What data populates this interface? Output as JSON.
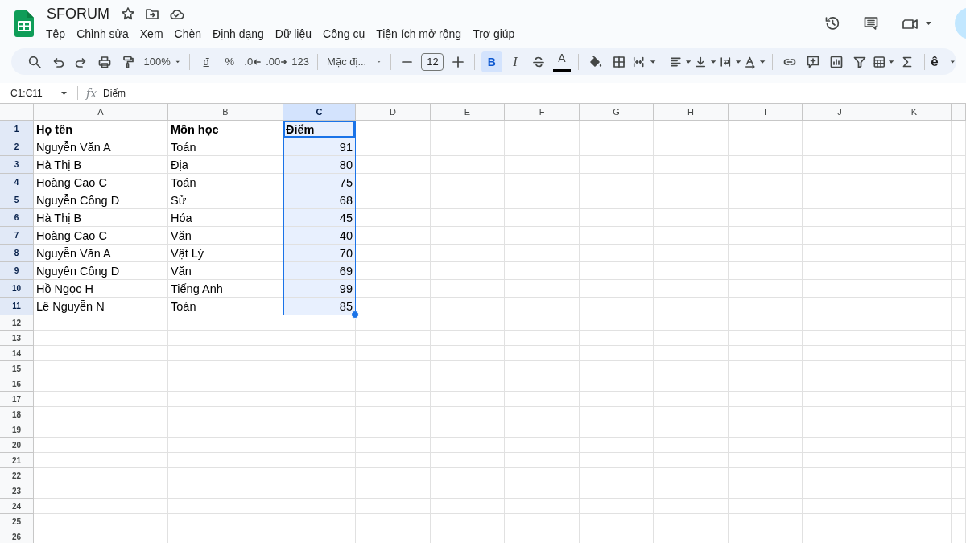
{
  "document": {
    "title": "SFORUM"
  },
  "menu": [
    "Tệp",
    "Chỉnh sửa",
    "Xem",
    "Chèn",
    "Định dạng",
    "Dữ liệu",
    "Công cụ",
    "Tiện ích mở rộng",
    "Trợ giúp"
  ],
  "toolbar": {
    "zoom": "100%",
    "currency": "đ",
    "percent": "%",
    "decrease_decimal": ".0",
    "increase_decimal": ".00",
    "number_format": "123",
    "font": "Mặc đị...",
    "font_size": "12",
    "bold": {
      "label": "B",
      "on": true
    },
    "italic": {
      "label": "I",
      "on": false
    },
    "text_color": {
      "label": "A",
      "color": "#000000"
    },
    "input_tools": "ê"
  },
  "formula_bar": {
    "name_box": "C1:C11",
    "fx": "fx",
    "value": "Điểm"
  },
  "columns": [
    {
      "label": "A",
      "selected": false,
      "align_right": false
    },
    {
      "label": "B",
      "selected": false,
      "align_right": false
    },
    {
      "label": "C",
      "selected": true,
      "align_right": true
    },
    {
      "label": "D",
      "selected": false
    },
    {
      "label": "E",
      "selected": false
    },
    {
      "label": "F",
      "selected": false
    },
    {
      "label": "G",
      "selected": false
    },
    {
      "label": "H",
      "selected": false
    },
    {
      "label": "I",
      "selected": false
    },
    {
      "label": "J",
      "selected": false
    },
    {
      "label": "K",
      "selected": false
    }
  ],
  "rows": [
    {
      "number": "1",
      "selected": true,
      "kind": "header",
      "cells": [
        "Họ tên",
        "Môn học",
        "Điểm"
      ]
    },
    {
      "number": "2",
      "selected": true,
      "kind": "data",
      "cells": [
        "Nguyễn Văn A",
        "Toán",
        "91"
      ]
    },
    {
      "number": "3",
      "selected": true,
      "kind": "data",
      "cells": [
        "Hà Thị B",
        "Địa",
        "80"
      ]
    },
    {
      "number": "4",
      "selected": true,
      "kind": "data",
      "cells": [
        "Hoàng Cao C",
        "Toán",
        "75"
      ]
    },
    {
      "number": "5",
      "selected": true,
      "kind": "data",
      "cells": [
        "Nguyễn Công D",
        "Sử",
        "68"
      ]
    },
    {
      "number": "6",
      "selected": true,
      "kind": "data",
      "cells": [
        "Hà Thị B",
        "Hóa",
        "45"
      ]
    },
    {
      "number": "7",
      "selected": true,
      "kind": "data",
      "cells": [
        "Hoàng Cao C",
        "Văn",
        "40"
      ]
    },
    {
      "number": "8",
      "selected": true,
      "kind": "data",
      "cells": [
        "Nguyễn Văn A",
        "Vật Lý",
        "70"
      ]
    },
    {
      "number": "9",
      "selected": true,
      "kind": "data",
      "cells": [
        "Nguyễn Công D",
        "Văn",
        "69"
      ]
    },
    {
      "number": "10",
      "selected": true,
      "kind": "data",
      "cells": [
        "Hồ Ngọc H",
        "Tiếng Anh",
        "99"
      ]
    },
    {
      "number": "11",
      "selected": true,
      "kind": "data",
      "cells": [
        "Lê Nguyễn N",
        "Toán",
        "85"
      ]
    },
    {
      "number": "12",
      "selected": false,
      "kind": "empty"
    },
    {
      "number": "13",
      "selected": false,
      "kind": "empty"
    },
    {
      "number": "14",
      "selected": false,
      "kind": "empty"
    },
    {
      "number": "15",
      "selected": false,
      "kind": "empty"
    },
    {
      "number": "16",
      "selected": false,
      "kind": "empty"
    },
    {
      "number": "17",
      "selected": false,
      "kind": "empty"
    },
    {
      "number": "18",
      "selected": false,
      "kind": "empty"
    },
    {
      "number": "19",
      "selected": false,
      "kind": "empty"
    },
    {
      "number": "20",
      "selected": false,
      "kind": "empty"
    },
    {
      "number": "21",
      "selected": false,
      "kind": "empty"
    },
    {
      "number": "22",
      "selected": false,
      "kind": "empty"
    },
    {
      "number": "23",
      "selected": false,
      "kind": "empty"
    },
    {
      "number": "24",
      "selected": false,
      "kind": "empty"
    },
    {
      "number": "25",
      "selected": false,
      "kind": "empty"
    },
    {
      "number": "26",
      "selected": false,
      "kind": "empty"
    }
  ]
}
